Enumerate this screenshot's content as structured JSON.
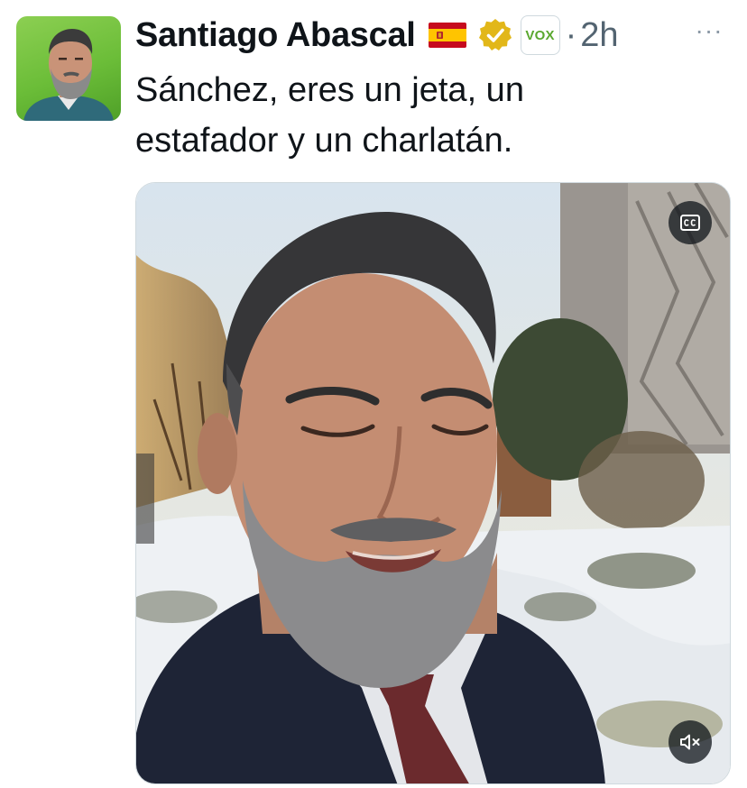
{
  "tweet": {
    "author_name": "Santiago Abascal",
    "affiliate_badge_text": "VOX",
    "separator": "·",
    "timestamp": "2h",
    "more_glyph": "···",
    "text_line_1": "Sánchez, eres un jeta, un",
    "text_line_2": "estafador y un charlatán."
  },
  "icons": {
    "flag": "spain-flag-icon",
    "verified": "gold-verified-badge-icon",
    "captions": "closed-captions-icon",
    "mute": "speaker-muted-icon"
  },
  "colors": {
    "text_primary": "#0f1419",
    "text_secondary": "#536471",
    "verified_gold": "#e2b719",
    "vox_green": "#5aa82f",
    "avatar_bg": "#7cc545"
  }
}
